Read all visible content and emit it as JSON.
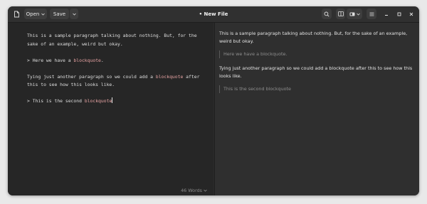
{
  "header": {
    "title": "• New File",
    "open_label": "Open",
    "save_label": "Save"
  },
  "editor": {
    "p1_line1": "This is a sample paragraph talking about nothing. But, for the",
    "p1_line2": "sake of an example, weird but okay.",
    "bq1_prefix": "> Here we have a ",
    "bq1_highlight": "blockquote",
    "bq1_suffix": ".",
    "p2_line1_a": "Tying just another paragraph so we could add a ",
    "p2_line1_hl": "blockquote",
    "p2_line1_b": " after",
    "p2_line2": "this to see how this looks like.",
    "bq2_prefix": "> This is the second ",
    "bq2_highlight": "blockquote"
  },
  "status": {
    "word_count": "46 Words"
  },
  "preview": {
    "p1": "This is a sample paragraph talking about nothing. But, for the sake of an example, weird but okay.",
    "bq1": "Here we have a blockquote.",
    "p2": "Tying just another paragraph so we could add a blockquote after this to see how this looks like.",
    "bq2": "This is the second blockquote"
  },
  "colors": {
    "highlight": "#e8a3a3",
    "editor_bg": "#262626",
    "preview_bg": "#2f2f2f"
  },
  "icons": [
    "new-document-icon",
    "chevron-down-icon",
    "search-icon",
    "preview-layout-icon",
    "toggle-icon",
    "menu-icon",
    "minimize-icon",
    "maximize-icon",
    "close-icon"
  ]
}
